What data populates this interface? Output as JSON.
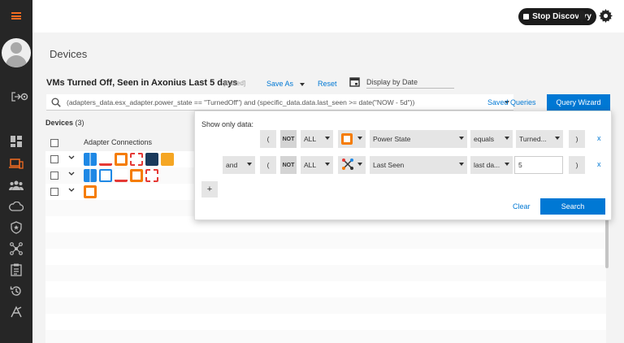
{
  "topbar": {
    "stop_label": "Stop Discovery"
  },
  "page": {
    "title": "Devices"
  },
  "query": {
    "name": "VMs Turned Off, Seen in Axonius Last 5 days",
    "edited": "[Edited]",
    "save_as": "Save As",
    "reset": "Reset",
    "display_by_date": "Display by Date",
    "text": "(adapters_data.esx_adapter.power_state == \"TurnedOff\") and (specific_data.data.last_seen >= date(\"NOW - 5d\"))",
    "saved_queries": "Saved Queries",
    "query_wizard": "Query Wizard"
  },
  "devices": {
    "label": "Devices",
    "count": "(3)",
    "column_header": "Adapter Connections"
  },
  "wizard": {
    "show_only": "Show only data:",
    "rows": [
      {
        "logic": "",
        "open": "(",
        "not": "NOT",
        "scope": "ALL",
        "field": "Power State",
        "op": "equals",
        "value": "Turned...",
        "close": ")",
        "remove": "x"
      },
      {
        "logic": "and",
        "open": "(",
        "not": "NOT",
        "scope": "ALL",
        "field": "Last Seen",
        "op": "last da...",
        "value": "5",
        "close": ")",
        "remove": "x"
      }
    ],
    "add": "+",
    "clear": "Clear",
    "search": "Search"
  },
  "colors": {
    "accent": "#0078d4",
    "brand": "#f26b21",
    "sidebar": "#262626"
  }
}
